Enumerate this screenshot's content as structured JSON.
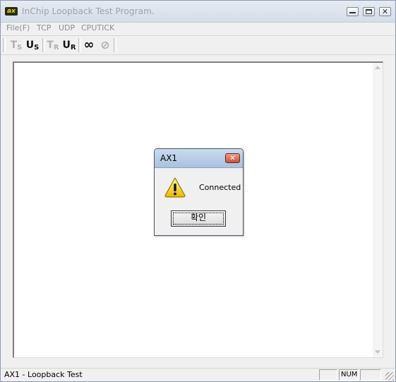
{
  "window": {
    "title": "InChip Loopback Test Program."
  },
  "menu": {
    "items": [
      "File(F)",
      "TCP",
      "UDP",
      "CPUTICK"
    ]
  },
  "toolbar": {
    "buttons": [
      {
        "label": "T",
        "sub": "S",
        "icon": "tcp-server-icon"
      },
      {
        "label": "U",
        "sub": "S",
        "icon": "udp-server-icon"
      },
      {
        "label": "T",
        "sub": "R",
        "icon": "tcp-receive-icon"
      },
      {
        "label": "U",
        "sub": "R",
        "icon": "udp-receive-icon"
      },
      {
        "label": "∞",
        "icon": "loop-icon"
      },
      {
        "label": "⊘",
        "icon": "stop-icon"
      }
    ]
  },
  "dialog": {
    "title": "AX1",
    "message": "Connected",
    "ok_label": "확인",
    "icon": "warning-icon"
  },
  "status": {
    "text": "AX1 - Loopback Test",
    "num": "NUM",
    "cap": "",
    "scrl": ""
  }
}
